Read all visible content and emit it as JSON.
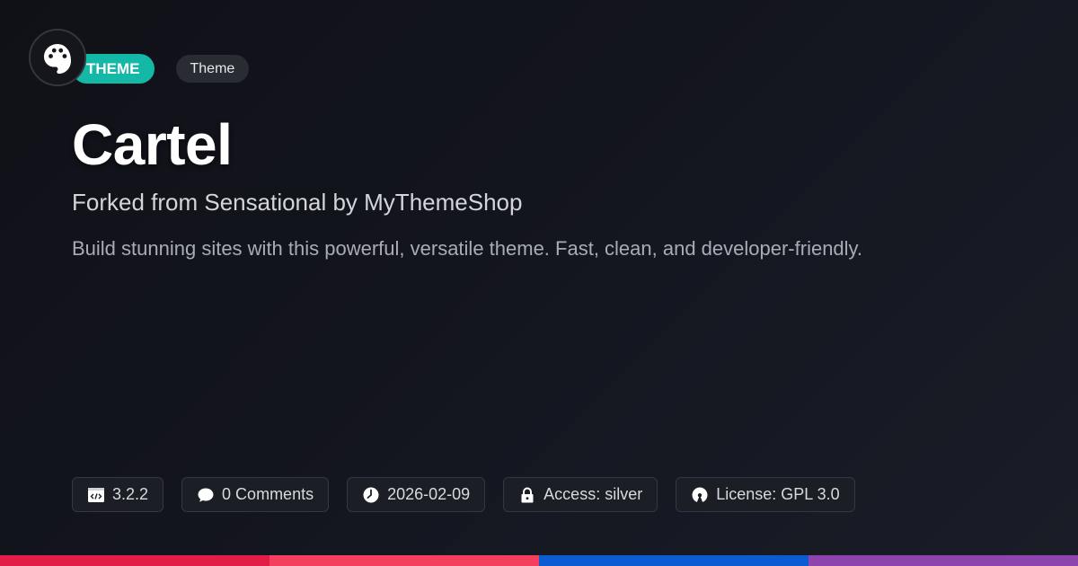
{
  "logo": {
    "icon": "palette-icon"
  },
  "badges": {
    "primary": "THEME",
    "secondary": "Theme"
  },
  "title": "Cartel",
  "subtitle": "Forked from Sensational by MyThemeShop",
  "description": "Build stunning sites with this powerful, versatile theme. Fast, clean, and developer-friendly.",
  "meta": {
    "version": {
      "icon": "code-icon",
      "label": "3.2.2"
    },
    "comments": {
      "icon": "comment-icon",
      "label": "0 Comments"
    },
    "date": {
      "icon": "clock-icon",
      "label": "2026-02-09"
    },
    "access": {
      "icon": "lock-icon",
      "label": "Access: silver"
    },
    "license": {
      "icon": "open-source-icon",
      "label": "License: GPL 3.0"
    }
  },
  "colors": {
    "accent": "#14b8a6",
    "bar": [
      "#e11d48",
      "#f43f5e",
      "#0b5bd3",
      "#8e44ad"
    ]
  }
}
